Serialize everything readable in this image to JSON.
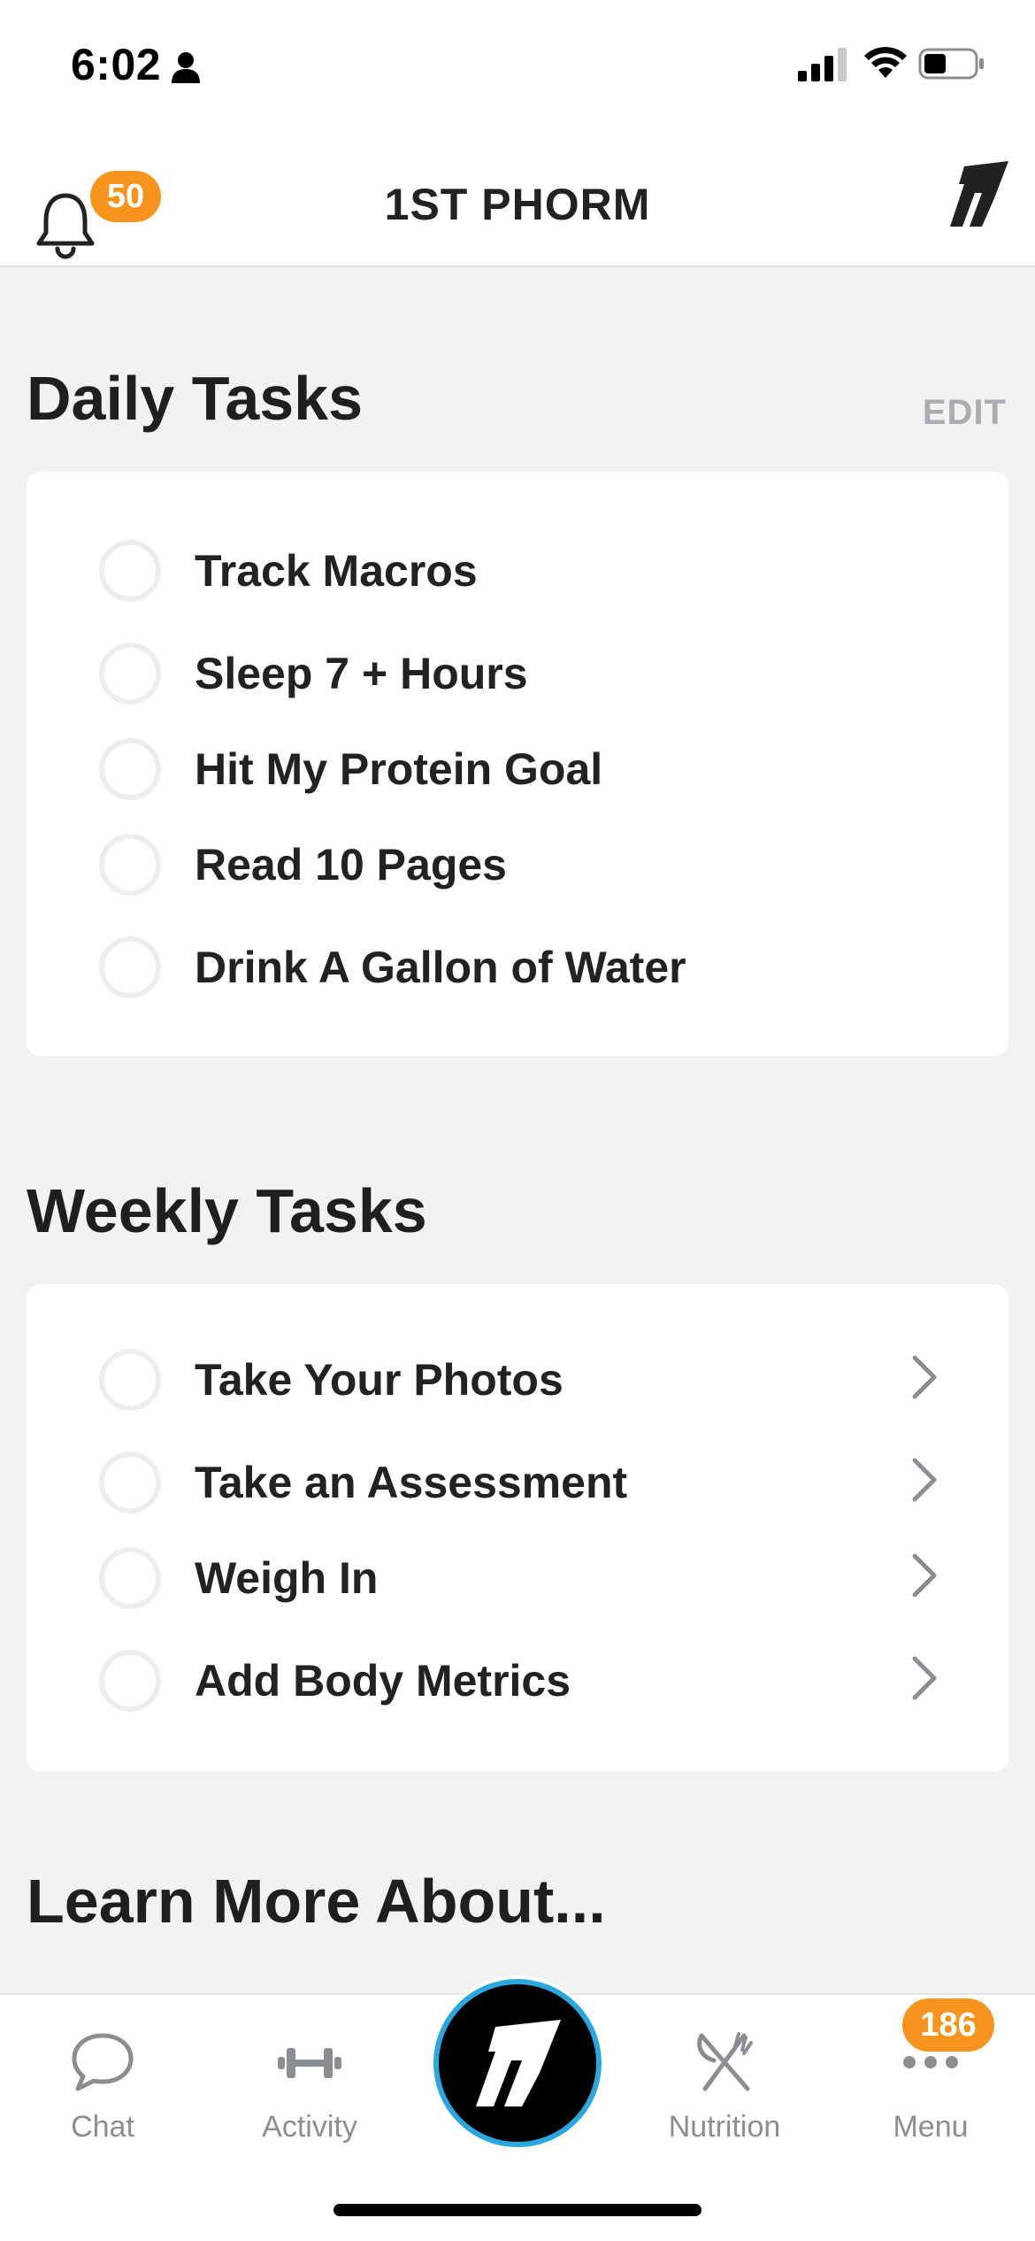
{
  "status_bar": {
    "time": "6:02"
  },
  "header": {
    "title": "1ST PHORM",
    "notification_count": "50"
  },
  "daily_tasks": {
    "title": "Daily Tasks",
    "edit_label": "EDIT",
    "items": [
      {
        "label": "Track Macros"
      },
      {
        "label": "Sleep 7 + Hours"
      },
      {
        "label": "Hit My Protein Goal"
      },
      {
        "label": "Read 10 Pages"
      },
      {
        "label": "Drink A Gallon of Water"
      }
    ]
  },
  "weekly_tasks": {
    "title": "Weekly Tasks",
    "items": [
      {
        "label": "Take Your Photos"
      },
      {
        "label": "Take an Assessment"
      },
      {
        "label": "Weigh In"
      },
      {
        "label": "Add Body Metrics"
      }
    ]
  },
  "learn_more": {
    "title": "Learn More About..."
  },
  "tab_bar": {
    "chat": {
      "label": "Chat",
      "icon": "chat-bubble-icon"
    },
    "activity": {
      "label": "Activity",
      "icon": "dumbbell-icon"
    },
    "center": {
      "icon": "phorm-logo-icon"
    },
    "nutrition": {
      "label": "Nutrition",
      "icon": "fork-knife-icon"
    },
    "menu": {
      "label": "Menu",
      "icon": "more-dots-icon",
      "badge": "186"
    }
  },
  "colors": {
    "accent_orange": "#f7941d",
    "center_ring_blue": "#29a8e0",
    "background": "#f2f2f3"
  }
}
